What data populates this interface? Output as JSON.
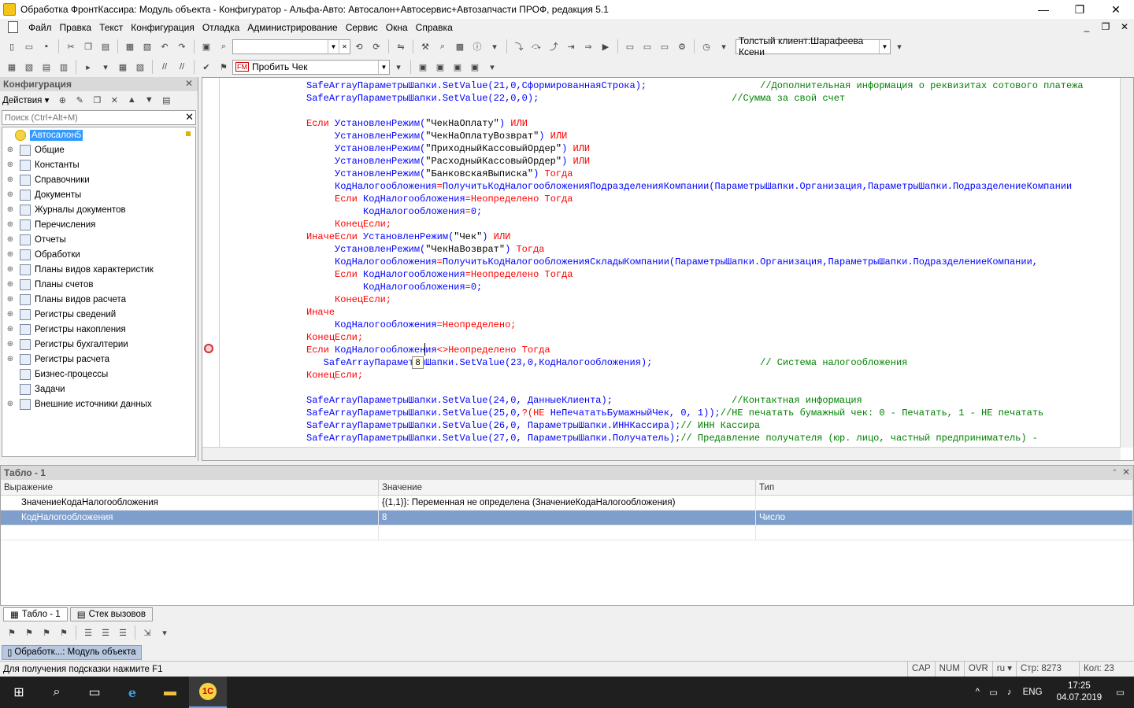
{
  "window": {
    "title": "Обработка ФронтКассира: Модуль объекта - Конфигуратор - Альфа-Авто: Автосалон+Автосервис+Автозапчасти ПРОФ, редакция 5.1",
    "min_glyph": "—",
    "max_glyph": "❐",
    "close_glyph": "✕"
  },
  "menu": {
    "items": [
      "Файл",
      "Правка",
      "Текст",
      "Конфигурация",
      "Отладка",
      "Администрирование",
      "Сервис",
      "Окна",
      "Справка"
    ],
    "right_controls": [
      "_",
      "❐",
      "✕"
    ]
  },
  "toolbar1": {
    "search_value": "",
    "client_combo": "Толстый клиент:Шарафеева Ксени"
  },
  "toolbar2": {
    "command_combo": "Пробить Чек"
  },
  "config_panel": {
    "title": "Конфигурация",
    "actions_label": "Действия ▾",
    "search_placeholder": "Поиск (Ctrl+Alt+M)",
    "root": "Автосалон5",
    "items": [
      "Общие",
      "Константы",
      "Справочники",
      "Документы",
      "Журналы документов",
      "Перечисления",
      "Отчеты",
      "Обработки",
      "Планы видов характеристик",
      "Планы счетов",
      "Планы видов расчета",
      "Регистры сведений",
      "Регистры накопления",
      "Регистры бухгалтерии",
      "Регистры расчета",
      "Бизнес-процессы",
      "Задачи",
      "Внешние источники данных"
    ]
  },
  "code": {
    "lines": [
      [
        [
          "id",
          "\t\t\tSafeArrayПараметрыШапки.SetValue(21,0,СформированнаяСтрока);"
        ],
        [
          "cm",
          "\t\t\t\t//Дополнительная информация о реквизитах сотового платежа"
        ]
      ],
      [
        [
          "id",
          "\t\t\tSafeArrayПараметрыШапки.SetValue(22,0,0);"
        ],
        [
          "cm",
          "\t\t\t\t\t\t\t//Сумма за свой счет"
        ]
      ],
      [],
      [
        [
          "kw",
          "\t\t\tЕсли "
        ],
        [
          "id",
          "УстановленРежим("
        ],
        [
          "st",
          "\"ЧекНаОплату\""
        ],
        [
          "id",
          ")"
        ],
        [
          "kw",
          " ИЛИ"
        ]
      ],
      [
        [
          "id",
          "\t\t\t\tУстановленРежим("
        ],
        [
          "st",
          "\"ЧекНаОплатуВозврат\""
        ],
        [
          "id",
          ")"
        ],
        [
          "kw",
          " ИЛИ"
        ]
      ],
      [
        [
          "id",
          "\t\t\t\tУстановленРежим("
        ],
        [
          "st",
          "\"ПриходныйКассовыйОрдер\""
        ],
        [
          "id",
          ")"
        ],
        [
          "kw",
          " ИЛИ"
        ]
      ],
      [
        [
          "id",
          "\t\t\t\tУстановленРежим("
        ],
        [
          "st",
          "\"РасходныйКассовыйОрдер\""
        ],
        [
          "id",
          ")"
        ],
        [
          "kw",
          " ИЛИ"
        ]
      ],
      [
        [
          "id",
          "\t\t\t\tУстановленРежим("
        ],
        [
          "st",
          "\"БанковскаяВыписка\""
        ],
        [
          "id",
          ")"
        ],
        [
          "kw",
          " Тогда"
        ]
      ],
      [
        [
          "id",
          "\t\t\t\tКодНалогообложения"
        ],
        [
          "kw",
          "="
        ],
        [
          "id",
          "ПолучитьКодНалогообложенияПодразделенияКомпании(ПараметрыШапки.Организация,ПараметрыШапки.ПодразделениеКомпании"
        ]
      ],
      [
        [
          "kw",
          "\t\t\t\tЕсли "
        ],
        [
          "id",
          "КодНалогообложения"
        ],
        [
          "kw",
          "=Неопределено Тогда"
        ]
      ],
      [
        [
          "id",
          "\t\t\t\t\tКодНалогообложения"
        ],
        [
          "kw",
          "="
        ],
        [
          "id",
          "0;"
        ]
      ],
      [
        [
          "kw",
          "\t\t\t\tКонецЕсли;"
        ]
      ],
      [
        [
          "kw",
          "\t\t\tИначеЕсли "
        ],
        [
          "id",
          "УстановленРежим("
        ],
        [
          "st",
          "\"Чек\""
        ],
        [
          "id",
          ")"
        ],
        [
          "kw",
          " ИЛИ"
        ]
      ],
      [
        [
          "id",
          "\t\t\t\tУстановленРежим("
        ],
        [
          "st",
          "\"ЧекНаВозврат\""
        ],
        [
          "id",
          ")"
        ],
        [
          "kw",
          " Тогда"
        ]
      ],
      [
        [
          "id",
          "\t\t\t\tКодНалогообложения"
        ],
        [
          "kw",
          "="
        ],
        [
          "id",
          "ПолучитьКодНалогообложенияСкладыКомпании(ПараметрыШапки.Организация,ПараметрыШапки.ПодразделениеКомпании,"
        ]
      ],
      [
        [
          "kw",
          "\t\t\t\tЕсли "
        ],
        [
          "id",
          "КодНалогообложения"
        ],
        [
          "kw",
          "=Неопределено Тогда"
        ]
      ],
      [
        [
          "id",
          "\t\t\t\t\tКодНалогообложения"
        ],
        [
          "kw",
          "="
        ],
        [
          "id",
          "0;"
        ]
      ],
      [
        [
          "kw",
          "\t\t\t\tКонецЕсли;"
        ]
      ],
      [
        [
          "kw",
          "\t\t\tИначе"
        ]
      ],
      [
        [
          "id",
          "\t\t\t\tКодНалогообложения"
        ],
        [
          "kw",
          "=Неопределено;"
        ]
      ],
      [
        [
          "kw",
          "\t\t\tКонецЕсли;"
        ]
      ],
      [
        [
          "kw",
          "\t\t\tЕсли "
        ],
        [
          "id",
          "КодНалогообложения"
        ],
        [
          "kw",
          "<>Неопределено Тогда"
        ]
      ],
      [
        [
          "id",
          "\t\t\t   SafeArrayПараметрыШапки.SetValue(23,0,КодНалогообложения);"
        ],
        [
          "cm",
          "\t\t\t\t// Система налогообложения"
        ]
      ],
      [
        [
          "kw",
          "\t\t\tКонецЕсли;"
        ]
      ],
      [],
      [
        [
          "id",
          "\t\t\tSafeArrayПараметрыШапки.SetValue(24,0, ДанныеКлиента);"
        ],
        [
          "cm",
          "\t\t\t\t\t//Контактная информация"
        ]
      ],
      [
        [
          "id",
          "\t\t\tSafeArrayПараметрыШапки.SetValue(25,0,"
        ],
        [
          "kw",
          "?(НЕ "
        ],
        [
          "id",
          "НеПечататьБумажныйЧек, 0, 1));"
        ],
        [
          "cm",
          "//НЕ печатать бумажный чек: 0 - Печатать, 1 - НЕ печатать"
        ]
      ],
      [
        [
          "id",
          "\t\t\tSafeArrayПараметрыШапки.SetValue(26,0, ПараметрыШапки.ИННКассира);"
        ],
        [
          "cm",
          "// ИНН Кассира"
        ]
      ],
      [
        [
          "id",
          "\t\t\tSafeArrayПараметрыШапки.SetValue(27,0, ПараметрыШапки.Получатель);"
        ],
        [
          "cm",
          "// Предавление получателя (юр. лицо, частный предприниматель) -"
        ]
      ]
    ],
    "hover_tooltip": "8"
  },
  "tablo": {
    "title": "Табло - 1",
    "columns": [
      "Выражение",
      "Значение",
      "Тип"
    ],
    "rows": [
      [
        "ЗначениеКодаНалогообложения",
        "{(1,1)}: Переменная не определена (ЗначениеКодаНалогообложения)",
        ""
      ],
      [
        "КодНалогообложения",
        "8",
        "Число"
      ]
    ]
  },
  "bottom_tabs": [
    "Табло - 1",
    "Стек вызовов"
  ],
  "window_list": [
    "Обработк...: Модуль объекта"
  ],
  "statusbar": {
    "hint": "Для получения подсказки нажмите F1",
    "cap": "CAP",
    "num": "NUM",
    "ovr": "OVR",
    "lang": "ru ▾",
    "line": "Стр: 8273",
    "col": "Кол: 23"
  },
  "taskbar": {
    "lang": "ENG",
    "time": "17:25",
    "date": "04.07.2019"
  }
}
